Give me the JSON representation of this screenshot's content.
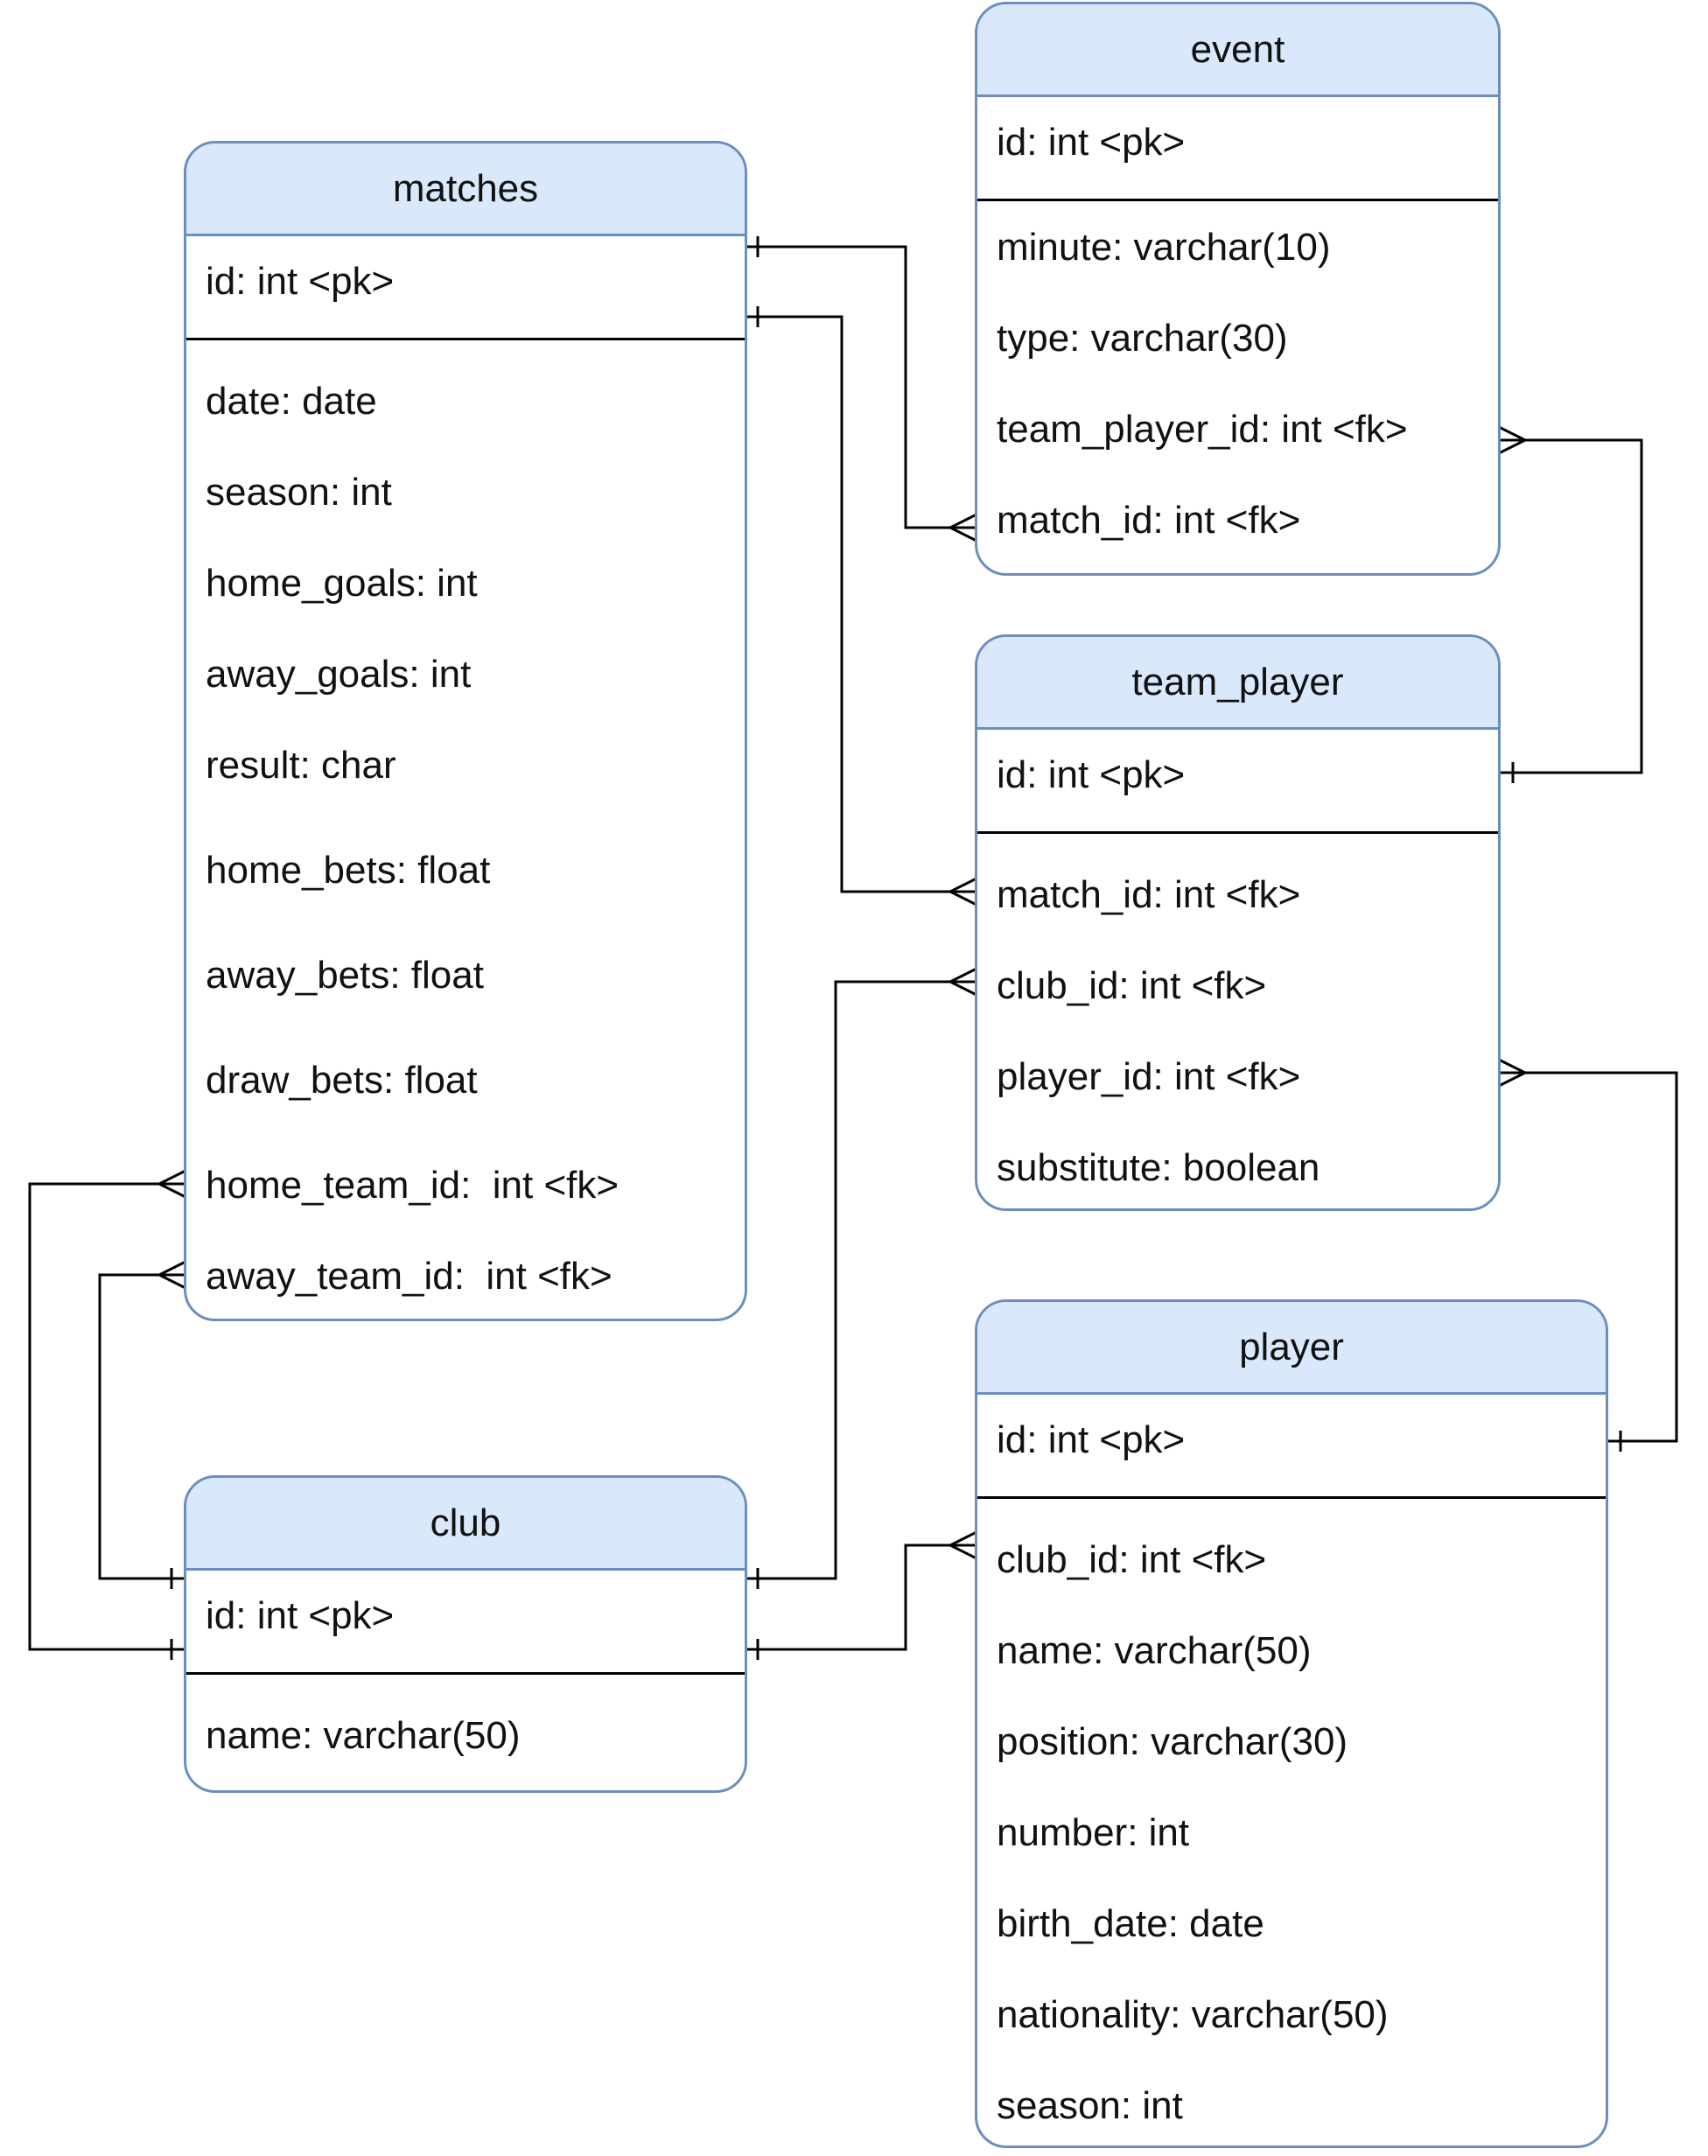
{
  "entities": {
    "event": {
      "title": "event",
      "pk": "id: int <pk>",
      "fields": [
        "minute: varchar(10)",
        "type: varchar(30)",
        "team_player_id: int <fk>",
        "match_id: int <fk>"
      ]
    },
    "matches": {
      "title": "matches",
      "pk": "id: int <pk>",
      "fields": [
        "date: date",
        "season: int",
        "home_goals: int",
        "away_goals: int",
        "result: char",
        "home_bets: float",
        "away_bets: float",
        "draw_bets: float",
        "home_team_id:  int <fk>",
        "away_team_id:  int <fk>"
      ]
    },
    "team_player": {
      "title": "team_player",
      "pk": "id: int <pk>",
      "fields": [
        "match_id: int <fk>",
        "club_id: int <fk>",
        "player_id: int <fk>",
        "substitute: boolean"
      ]
    },
    "club": {
      "title": "club",
      "pk": "id: int <pk>",
      "fields": [
        "name: varchar(50)"
      ]
    },
    "player": {
      "title": "player",
      "pk": "id: int <pk>",
      "fields": [
        "club_id: int <fk>",
        "name: varchar(50)",
        "position: varchar(30)",
        "number: int",
        "birth_date: date",
        "nationality: varchar(50)",
        "season: int"
      ]
    }
  },
  "relationships": [
    {
      "from": "matches.id",
      "to": "event.match_id",
      "cardinality": "one-to-many"
    },
    {
      "from": "team_player.id",
      "to": "event.team_player_id",
      "cardinality": "one-to-many"
    },
    {
      "from": "matches.id",
      "to": "team_player.match_id",
      "cardinality": "one-to-many"
    },
    {
      "from": "club.id",
      "to": "team_player.club_id",
      "cardinality": "one-to-many"
    },
    {
      "from": "player.id",
      "to": "team_player.player_id",
      "cardinality": "one-to-many"
    },
    {
      "from": "club.id",
      "to": "matches.home_team_id",
      "cardinality": "one-to-many"
    },
    {
      "from": "club.id",
      "to": "matches.away_team_id",
      "cardinality": "one-to-many"
    },
    {
      "from": "club.id",
      "to": "player.club_id",
      "cardinality": "one-to-many"
    }
  ],
  "colors": {
    "header_fill": "#dae8fc",
    "border": "#6c8ebf",
    "line": "#000000"
  }
}
